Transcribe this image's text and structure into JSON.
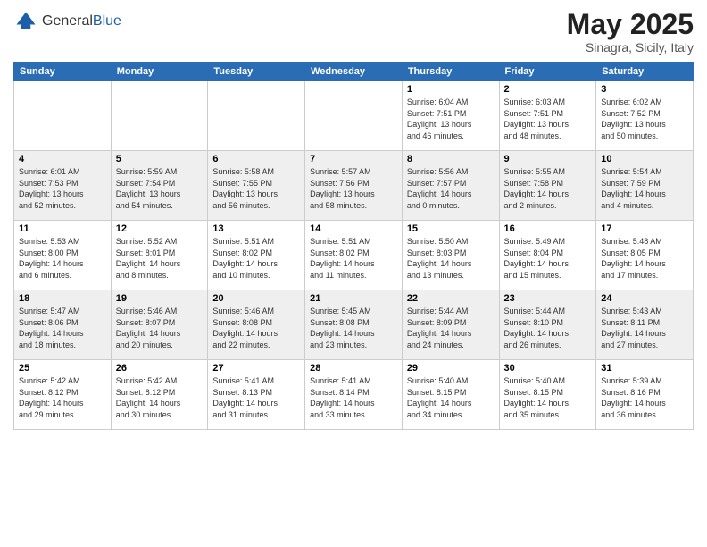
{
  "header": {
    "logo_general": "General",
    "logo_blue": "Blue",
    "month": "May 2025",
    "location": "Sinagra, Sicily, Italy"
  },
  "weekdays": [
    "Sunday",
    "Monday",
    "Tuesday",
    "Wednesday",
    "Thursday",
    "Friday",
    "Saturday"
  ],
  "rows": [
    [
      {
        "day": "",
        "info": ""
      },
      {
        "day": "",
        "info": ""
      },
      {
        "day": "",
        "info": ""
      },
      {
        "day": "",
        "info": ""
      },
      {
        "day": "1",
        "info": "Sunrise: 6:04 AM\nSunset: 7:51 PM\nDaylight: 13 hours\nand 46 minutes."
      },
      {
        "day": "2",
        "info": "Sunrise: 6:03 AM\nSunset: 7:51 PM\nDaylight: 13 hours\nand 48 minutes."
      },
      {
        "day": "3",
        "info": "Sunrise: 6:02 AM\nSunset: 7:52 PM\nDaylight: 13 hours\nand 50 minutes."
      }
    ],
    [
      {
        "day": "4",
        "info": "Sunrise: 6:01 AM\nSunset: 7:53 PM\nDaylight: 13 hours\nand 52 minutes."
      },
      {
        "day": "5",
        "info": "Sunrise: 5:59 AM\nSunset: 7:54 PM\nDaylight: 13 hours\nand 54 minutes."
      },
      {
        "day": "6",
        "info": "Sunrise: 5:58 AM\nSunset: 7:55 PM\nDaylight: 13 hours\nand 56 minutes."
      },
      {
        "day": "7",
        "info": "Sunrise: 5:57 AM\nSunset: 7:56 PM\nDaylight: 13 hours\nand 58 minutes."
      },
      {
        "day": "8",
        "info": "Sunrise: 5:56 AM\nSunset: 7:57 PM\nDaylight: 14 hours\nand 0 minutes."
      },
      {
        "day": "9",
        "info": "Sunrise: 5:55 AM\nSunset: 7:58 PM\nDaylight: 14 hours\nand 2 minutes."
      },
      {
        "day": "10",
        "info": "Sunrise: 5:54 AM\nSunset: 7:59 PM\nDaylight: 14 hours\nand 4 minutes."
      }
    ],
    [
      {
        "day": "11",
        "info": "Sunrise: 5:53 AM\nSunset: 8:00 PM\nDaylight: 14 hours\nand 6 minutes."
      },
      {
        "day": "12",
        "info": "Sunrise: 5:52 AM\nSunset: 8:01 PM\nDaylight: 14 hours\nand 8 minutes."
      },
      {
        "day": "13",
        "info": "Sunrise: 5:51 AM\nSunset: 8:02 PM\nDaylight: 14 hours\nand 10 minutes."
      },
      {
        "day": "14",
        "info": "Sunrise: 5:51 AM\nSunset: 8:02 PM\nDaylight: 14 hours\nand 11 minutes."
      },
      {
        "day": "15",
        "info": "Sunrise: 5:50 AM\nSunset: 8:03 PM\nDaylight: 14 hours\nand 13 minutes."
      },
      {
        "day": "16",
        "info": "Sunrise: 5:49 AM\nSunset: 8:04 PM\nDaylight: 14 hours\nand 15 minutes."
      },
      {
        "day": "17",
        "info": "Sunrise: 5:48 AM\nSunset: 8:05 PM\nDaylight: 14 hours\nand 17 minutes."
      }
    ],
    [
      {
        "day": "18",
        "info": "Sunrise: 5:47 AM\nSunset: 8:06 PM\nDaylight: 14 hours\nand 18 minutes."
      },
      {
        "day": "19",
        "info": "Sunrise: 5:46 AM\nSunset: 8:07 PM\nDaylight: 14 hours\nand 20 minutes."
      },
      {
        "day": "20",
        "info": "Sunrise: 5:46 AM\nSunset: 8:08 PM\nDaylight: 14 hours\nand 22 minutes."
      },
      {
        "day": "21",
        "info": "Sunrise: 5:45 AM\nSunset: 8:08 PM\nDaylight: 14 hours\nand 23 minutes."
      },
      {
        "day": "22",
        "info": "Sunrise: 5:44 AM\nSunset: 8:09 PM\nDaylight: 14 hours\nand 24 minutes."
      },
      {
        "day": "23",
        "info": "Sunrise: 5:44 AM\nSunset: 8:10 PM\nDaylight: 14 hours\nand 26 minutes."
      },
      {
        "day": "24",
        "info": "Sunrise: 5:43 AM\nSunset: 8:11 PM\nDaylight: 14 hours\nand 27 minutes."
      }
    ],
    [
      {
        "day": "25",
        "info": "Sunrise: 5:42 AM\nSunset: 8:12 PM\nDaylight: 14 hours\nand 29 minutes."
      },
      {
        "day": "26",
        "info": "Sunrise: 5:42 AM\nSunset: 8:12 PM\nDaylight: 14 hours\nand 30 minutes."
      },
      {
        "day": "27",
        "info": "Sunrise: 5:41 AM\nSunset: 8:13 PM\nDaylight: 14 hours\nand 31 minutes."
      },
      {
        "day": "28",
        "info": "Sunrise: 5:41 AM\nSunset: 8:14 PM\nDaylight: 14 hours\nand 33 minutes."
      },
      {
        "day": "29",
        "info": "Sunrise: 5:40 AM\nSunset: 8:15 PM\nDaylight: 14 hours\nand 34 minutes."
      },
      {
        "day": "30",
        "info": "Sunrise: 5:40 AM\nSunset: 8:15 PM\nDaylight: 14 hours\nand 35 minutes."
      },
      {
        "day": "31",
        "info": "Sunrise: 5:39 AM\nSunset: 8:16 PM\nDaylight: 14 hours\nand 36 minutes."
      }
    ]
  ]
}
